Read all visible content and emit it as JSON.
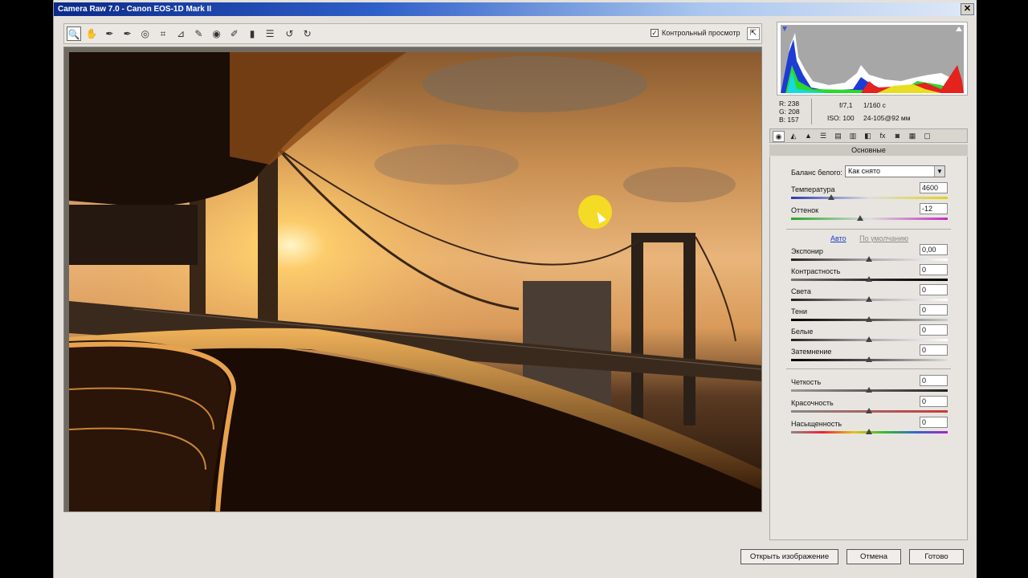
{
  "window": {
    "title": "Camera Raw 7.0  -  Canon EOS-1D Mark II",
    "close_glyph": "✕"
  },
  "toolbar": {
    "tools": [
      {
        "name": "zoom-tool",
        "glyph": "🔍",
        "active": true
      },
      {
        "name": "hand-tool",
        "glyph": "✋"
      },
      {
        "name": "white-balance-tool",
        "glyph": "✒"
      },
      {
        "name": "color-sampler-tool",
        "glyph": "✒"
      },
      {
        "name": "target-adjust-tool",
        "glyph": "◎"
      },
      {
        "name": "crop-tool",
        "glyph": "⌗"
      },
      {
        "name": "straighten-tool",
        "glyph": "⊿"
      },
      {
        "name": "spot-removal-tool",
        "glyph": "✎"
      },
      {
        "name": "red-eye-tool",
        "glyph": "◉"
      },
      {
        "name": "adjustment-brush-tool",
        "glyph": "✐"
      },
      {
        "name": "graduated-filter-tool",
        "glyph": "▮"
      },
      {
        "name": "preferences-tool",
        "glyph": "☰"
      },
      {
        "name": "rotate-left-tool",
        "glyph": "↺"
      },
      {
        "name": "rotate-right-tool",
        "glyph": "↻"
      }
    ],
    "preview_label": "Контрольный просмотр",
    "preview_checked": "✓",
    "fullscreen_glyph": "⇱"
  },
  "info": {
    "r_label": "R:",
    "r_value": "238",
    "g_label": "G:",
    "g_value": "208",
    "b_label": "B:",
    "b_value": "157",
    "aperture": "f/7,1",
    "shutter": "1/160 с",
    "iso": "ISO: 100",
    "lens": "24-105@92 мм"
  },
  "panel": {
    "tabs": [
      "◉",
      "◭",
      "▲",
      "☰",
      "▤",
      "▥",
      "◧",
      "fx",
      "◙",
      "▦",
      "▢"
    ],
    "title": "Основные",
    "wb_label": "Баланс белого:",
    "wb_value": "Как снято",
    "wb_arrow": "▼",
    "temp_label": "Температура",
    "temp_value": "4600",
    "tint_label": "Оттенок",
    "tint_value": "-12",
    "auto_label": "Авто",
    "default_label": "По умолчанию",
    "exposure_label": "Экспонир",
    "exposure_value": "0,00",
    "contrast_label": "Контрастность",
    "contrast_value": "0",
    "highlights_label": "Света",
    "highlights_value": "0",
    "shadows_label": "Тени",
    "shadows_value": "0",
    "whites_label": "Белые",
    "whites_value": "0",
    "blacks_label": "Затемнение",
    "blacks_value": "0",
    "clarity_label": "Четкость",
    "clarity_value": "0",
    "vibrance_label": "Красочность",
    "vibrance_value": "0",
    "saturation_label": "Насыщенность",
    "saturation_value": "0"
  },
  "buttons": {
    "open": "Открыть изображение",
    "cancel": "Отмена",
    "done": "Готово"
  },
  "colors": {
    "titlebar": "#0b2a8a",
    "highlight": "#f7e11e"
  }
}
